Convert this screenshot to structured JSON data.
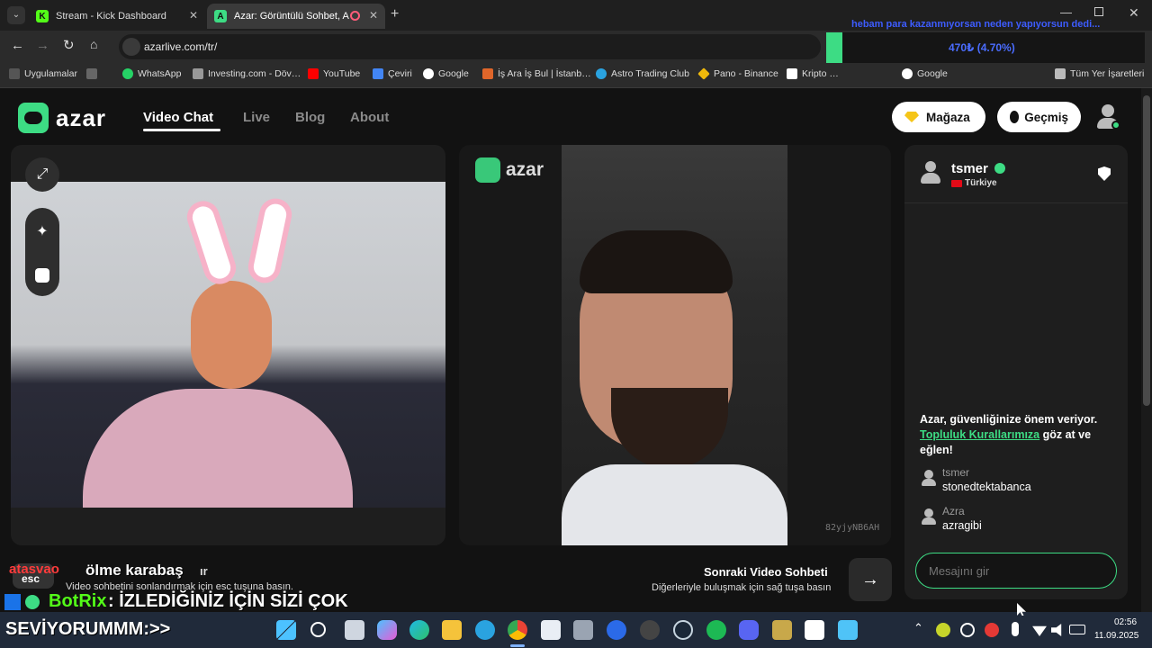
{
  "browser": {
    "tabs": [
      {
        "title": "Stream - Kick Dashboard",
        "favicon": "K"
      },
      {
        "title": "Azar: Görüntülü Sohbet, Ar…",
        "favicon": "A"
      }
    ],
    "url": "azarlive.com/tr/",
    "bookmarks": [
      "Uygulamalar",
      "WhatsApp",
      "Investing.com - Döv…",
      "YouTube",
      "Çeviri",
      "Google",
      "İş Ara İş Bul | İstanb…",
      "Astro Trading Club",
      "Pano - Binance",
      "Kripto …",
      "Google",
      "Tüm Yer İşaretleri"
    ]
  },
  "stream_overlay": {
    "ticker_headline": "hebam para kazanmıyorsan neden yapıyorsun dedi...",
    "ticker_value": "470₺ (4.70%)",
    "chat_user": "atasvao",
    "chat_message": "ölme karabaş",
    "chat_suffix": "ır",
    "bot_name": "BotRix",
    "bot_message": ": İZLEDİĞİNİZ İÇİN SİZİ ÇOK",
    "bot_message_2": "SEVİYORUMMM:>>",
    "esc_label": "esc",
    "esc_hint": "Video sohbetini sonlandırmak için esc tuşuna basın."
  },
  "site": {
    "logo": "azar",
    "nav": [
      "Video Chat",
      "Live",
      "Blog",
      "About"
    ],
    "shop_label": "Mağaza",
    "history_label": "Geçmiş",
    "video_id": "82yjyNB6AH",
    "next_title": "Sonraki Video Sohbeti",
    "next_sub": "Diğerleriyle buluşmak için sağ tuşa basın"
  },
  "chat": {
    "peer_name": "tsmer",
    "peer_country": "Türkiye",
    "safety_line1": "Azar, güvenliğinize önem veriyor.",
    "safety_link": "Topluluk Kurallarımıza",
    "safety_rest": " göz at ve",
    "safety_line3": "eğlen!",
    "messages": [
      {
        "user": "tsmer",
        "text": "stonedtektabanca"
      },
      {
        "user": "Azra",
        "text": "azragibi"
      }
    ],
    "input_placeholder": "Mesajını gir"
  },
  "taskbar": {
    "time": "02:56",
    "date": "11.09.2025"
  },
  "colors": {
    "accent_green": "#3ddc84",
    "page_bg": "#121212",
    "panel_bg": "#1e1e1e"
  }
}
